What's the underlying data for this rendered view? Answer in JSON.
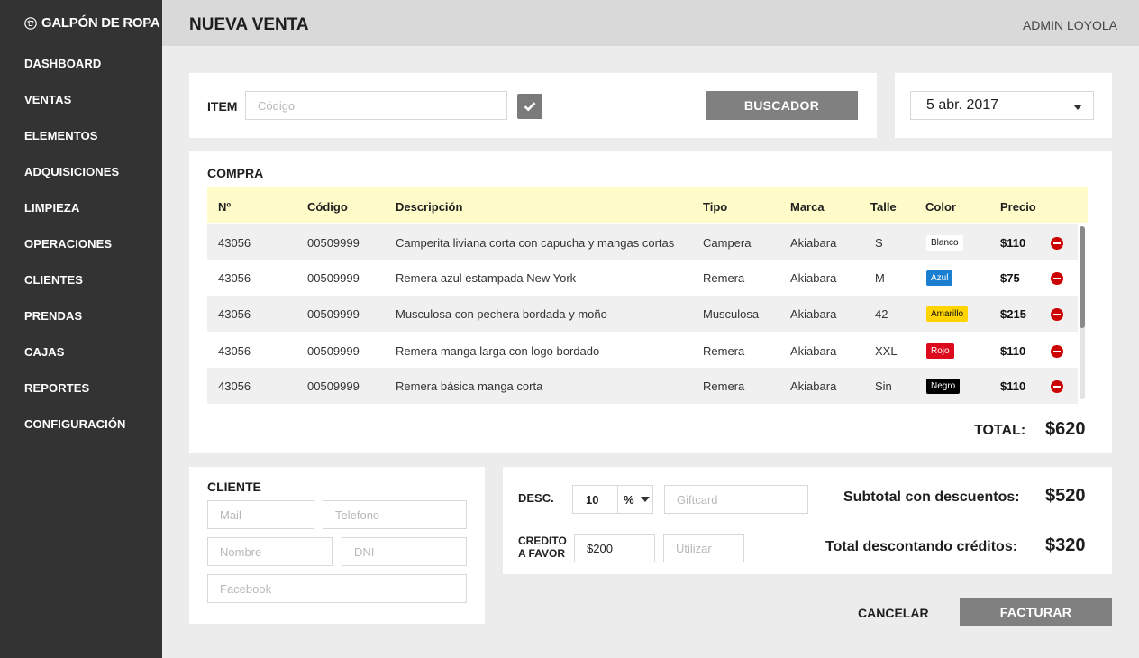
{
  "brand": {
    "name": "GALPÓN DE ROPA",
    "icon": "shirt-logo-icon"
  },
  "nav": [
    "DASHBOARD",
    "VENTAS",
    "ELEMENTOS",
    "ADQUISICIONES",
    "LIMPIEZA",
    "OPERACIONES",
    "CLIENTES",
    "PRENDAS",
    "CAJAS",
    "REPORTES",
    "CONFIGURACIÓN"
  ],
  "header": {
    "title": "NUEVA VENTA",
    "user": "ADMIN LOYOLA"
  },
  "item": {
    "label": "ITEM",
    "placeholder": "Código",
    "search_button": "BUSCADOR"
  },
  "date": {
    "value": "5 abr. 2017"
  },
  "purchase": {
    "title": "COMPRA",
    "columns": [
      "Nº",
      "Código",
      "Descripción",
      "Tipo",
      "Marca",
      "Talle",
      "Color",
      "Precio"
    ],
    "rows": [
      {
        "num": "43056",
        "code": "00509999",
        "desc": "Camperita liviana corta con capucha y mangas cortas",
        "type": "Campera",
        "brand": "Akiabara",
        "size": "S",
        "color": "Blanco",
        "price": "$110"
      },
      {
        "num": "43056",
        "code": "00509999",
        "desc": "Remera azul estampada New York",
        "type": "Remera",
        "brand": "Akiabara",
        "size": "M",
        "color": "Azul",
        "price": "$75"
      },
      {
        "num": "43056",
        "code": "00509999",
        "desc": "Musculosa con pechera bordada y moño",
        "type": "Musculosa",
        "brand": "Akiabara",
        "size": "42",
        "color": "Amarillo",
        "price": "$215"
      },
      {
        "num": "43056",
        "code": "00509999",
        "desc": "Remera manga larga con logo bordado",
        "type": "Remera",
        "brand": "Akiabara",
        "size": "XXL",
        "color": "Rojo",
        "price": "$110"
      },
      {
        "num": "43056",
        "code": "00509999",
        "desc": "Remera básica manga corta",
        "type": "Remera",
        "brand": "Akiabara",
        "size": "Sin",
        "color": "Negro",
        "price": "$110"
      }
    ],
    "total_label": "TOTAL:",
    "total_value": "$620"
  },
  "client": {
    "title": "CLIENTE",
    "mail_placeholder": "Mail",
    "phone_placeholder": "Telefono",
    "name_placeholder": "Nombre",
    "dni_placeholder": "DNI",
    "facebook_placeholder": "Facebook"
  },
  "discounts": {
    "desc_label": "DESC.",
    "desc_value": "10",
    "desc_unit": "%",
    "giftcard_placeholder": "Giftcard",
    "credit_label_1": "CREDITO",
    "credit_label_2": "A FAVOR",
    "credit_value": "$200",
    "use_placeholder": "Utilizar",
    "subtotal_label": "Subtotal con descuentos:",
    "subtotal_value": "$520",
    "net_label": "Total descontando créditos:",
    "net_value": "$320"
  },
  "actions": {
    "cancel": "CANCELAR",
    "invoice": "FACTURAR"
  },
  "badge_colors": {
    "Blanco": {
      "bg": "#ffffff",
      "fg": "#111111"
    },
    "Azul": {
      "bg": "#1a7ed1",
      "fg": "#ffffff"
    },
    "Amarillo": {
      "bg": "#ffd400",
      "fg": "#111111"
    },
    "Rojo": {
      "bg": "#dd0a1e",
      "fg": "#ffffff"
    },
    "Negro": {
      "bg": "#000000",
      "fg": "#ffffff"
    }
  }
}
